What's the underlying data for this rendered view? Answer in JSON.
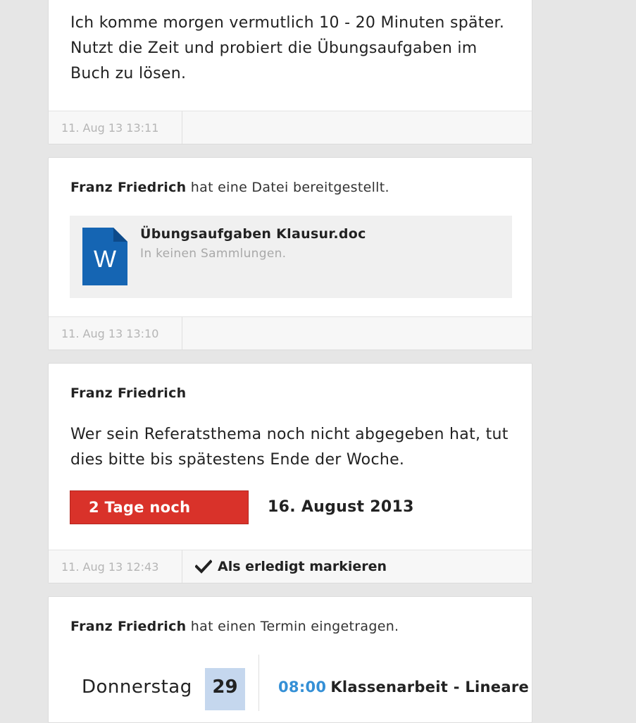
{
  "feed": {
    "post1": {
      "text": "Ich komme morgen vermutlich 10 - 20 Minuten später. Nutzt die Zeit und probiert die Übungsaufgaben im Buch zu lösen.",
      "timestamp": "11. Aug 13 13:11"
    },
    "post2": {
      "author": "Franz Friedrich",
      "action": " hat eine Datei bereitgestellt.",
      "file": {
        "icon": "word-document-icon",
        "icon_letter": "W",
        "name": "Übungsaufgaben Klausur.doc",
        "collections": "In keinen Sammlungen."
      },
      "timestamp": "11. Aug 13 13:10"
    },
    "post3": {
      "author": "Franz Friedrich",
      "text": "Wer sein Referatsthema noch nicht abgegeben hat, tut dies bitte bis spätestens Ende der Woche.",
      "deadline_badge": "2 Tage noch",
      "deadline_date": "16. August 2013",
      "timestamp": "11. Aug 13 12:43",
      "mark_done": "Als erledigt markieren"
    },
    "post4": {
      "author": "Franz Friedrich",
      "action": " hat einen Termin eingetragen.",
      "weekday": "Donnerstag",
      "day": "29",
      "event_time": "08:00",
      "event_title": "Klassenarbeit - Lineare"
    }
  },
  "colors": {
    "badge_red": "#d9322a",
    "word_blue": "#1565b3",
    "time_blue": "#3590d6",
    "day_highlight": "#c5d7ee"
  }
}
